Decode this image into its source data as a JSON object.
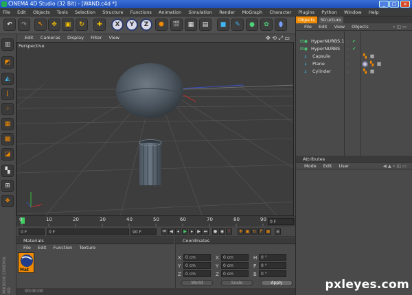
{
  "window": {
    "title": "CINEMA 4D Studio (32 Bit) - [WAND.c4d *]",
    "min": "_",
    "max": "□",
    "close": "×"
  },
  "menu": [
    "File",
    "Edit",
    "Objects",
    "Tools",
    "Selection",
    "Structure",
    "Functions",
    "Animation",
    "Simulation",
    "Render",
    "MoGraph",
    "Character",
    "Plugins",
    "Python",
    "Window",
    "Help"
  ],
  "toolbar": {
    "x": "X",
    "y": "Y",
    "z": "Z"
  },
  "viewport": {
    "menu": [
      "Edit",
      "Cameras",
      "Display",
      "Filter",
      "View"
    ],
    "label": "Perspective"
  },
  "timeline": {
    "ticks": [
      "0",
      "10",
      "20",
      "30",
      "40",
      "50",
      "60",
      "70",
      "80",
      "90"
    ],
    "current_frame": "0 F"
  },
  "transport": {
    "start": "0 F",
    "preview_start": "0 F",
    "preview_end": "90 F",
    "end": "90 F"
  },
  "objects_panel": {
    "tabs": [
      "Objects",
      "Structure"
    ],
    "menu": [
      "File",
      "Edit",
      "View",
      "Objects"
    ],
    "items": [
      {
        "name": "HyperNURBS.1"
      },
      {
        "name": "HyperNURBS"
      },
      {
        "name": "Capsule"
      },
      {
        "name": "Plane"
      },
      {
        "name": "Cylinder"
      }
    ]
  },
  "attributes_panel": {
    "title": "Attributes",
    "menu": [
      "Mode",
      "Edit",
      "User"
    ]
  },
  "materials_panel": {
    "title": "Materials",
    "menu": [
      "File",
      "Edit",
      "Function",
      "Texture"
    ],
    "material_name": "Mat"
  },
  "coordinates_panel": {
    "title": "Coordinates",
    "rows": [
      {
        "a": "X",
        "av": "0 cm",
        "b": "X",
        "bv": "0 cm",
        "c": "H",
        "cv": "0 °"
      },
      {
        "a": "Y",
        "av": "0 cm",
        "b": "Y",
        "bv": "0 cm",
        "c": "P",
        "cv": "0 °"
      },
      {
        "a": "Z",
        "av": "0 cm",
        "b": "Z",
        "bv": "0 cm",
        "c": "B",
        "cv": "0 °"
      }
    ],
    "world": "World",
    "scale": "Scale",
    "apply": "Apply"
  },
  "status": {
    "time": "00:00:00"
  },
  "branding": {
    "vertical": "MAXON CINEMA 4D",
    "watermark": "pxleyes.com"
  },
  "colors": {
    "accent": "#f08a00",
    "title_blue": "#2a5fcc",
    "viewport": "#3d3d3d"
  }
}
